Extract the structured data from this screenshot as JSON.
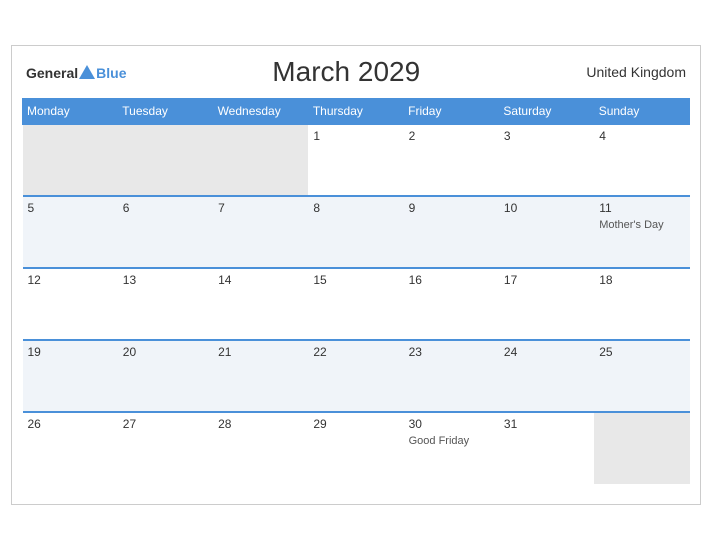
{
  "header": {
    "title": "March 2029",
    "region": "United Kingdom",
    "logo_general": "General",
    "logo_blue": "Blue"
  },
  "days_of_week": [
    "Monday",
    "Tuesday",
    "Wednesday",
    "Thursday",
    "Friday",
    "Saturday",
    "Sunday"
  ],
  "weeks": [
    {
      "row_class": "row-white",
      "days": [
        {
          "date": "",
          "empty": true
        },
        {
          "date": "",
          "empty": true
        },
        {
          "date": "",
          "empty": true
        },
        {
          "date": "1",
          "empty": false,
          "event": ""
        },
        {
          "date": "2",
          "empty": false,
          "event": ""
        },
        {
          "date": "3",
          "empty": false,
          "event": ""
        },
        {
          "date": "4",
          "empty": false,
          "event": ""
        }
      ]
    },
    {
      "row_class": "row-gray",
      "days": [
        {
          "date": "5",
          "empty": false,
          "event": ""
        },
        {
          "date": "6",
          "empty": false,
          "event": ""
        },
        {
          "date": "7",
          "empty": false,
          "event": ""
        },
        {
          "date": "8",
          "empty": false,
          "event": ""
        },
        {
          "date": "9",
          "empty": false,
          "event": ""
        },
        {
          "date": "10",
          "empty": false,
          "event": ""
        },
        {
          "date": "11",
          "empty": false,
          "event": "Mother's Day"
        }
      ]
    },
    {
      "row_class": "row-white",
      "days": [
        {
          "date": "12",
          "empty": false,
          "event": ""
        },
        {
          "date": "13",
          "empty": false,
          "event": ""
        },
        {
          "date": "14",
          "empty": false,
          "event": ""
        },
        {
          "date": "15",
          "empty": false,
          "event": ""
        },
        {
          "date": "16",
          "empty": false,
          "event": ""
        },
        {
          "date": "17",
          "empty": false,
          "event": ""
        },
        {
          "date": "18",
          "empty": false,
          "event": ""
        }
      ]
    },
    {
      "row_class": "row-gray",
      "days": [
        {
          "date": "19",
          "empty": false,
          "event": ""
        },
        {
          "date": "20",
          "empty": false,
          "event": ""
        },
        {
          "date": "21",
          "empty": false,
          "event": ""
        },
        {
          "date": "22",
          "empty": false,
          "event": ""
        },
        {
          "date": "23",
          "empty": false,
          "event": ""
        },
        {
          "date": "24",
          "empty": false,
          "event": ""
        },
        {
          "date": "25",
          "empty": false,
          "event": ""
        }
      ]
    },
    {
      "row_class": "row-white",
      "days": [
        {
          "date": "26",
          "empty": false,
          "event": ""
        },
        {
          "date": "27",
          "empty": false,
          "event": ""
        },
        {
          "date": "28",
          "empty": false,
          "event": ""
        },
        {
          "date": "29",
          "empty": false,
          "event": ""
        },
        {
          "date": "30",
          "empty": false,
          "event": "Good Friday"
        },
        {
          "date": "31",
          "empty": false,
          "event": ""
        },
        {
          "date": "",
          "empty": true
        }
      ]
    }
  ]
}
